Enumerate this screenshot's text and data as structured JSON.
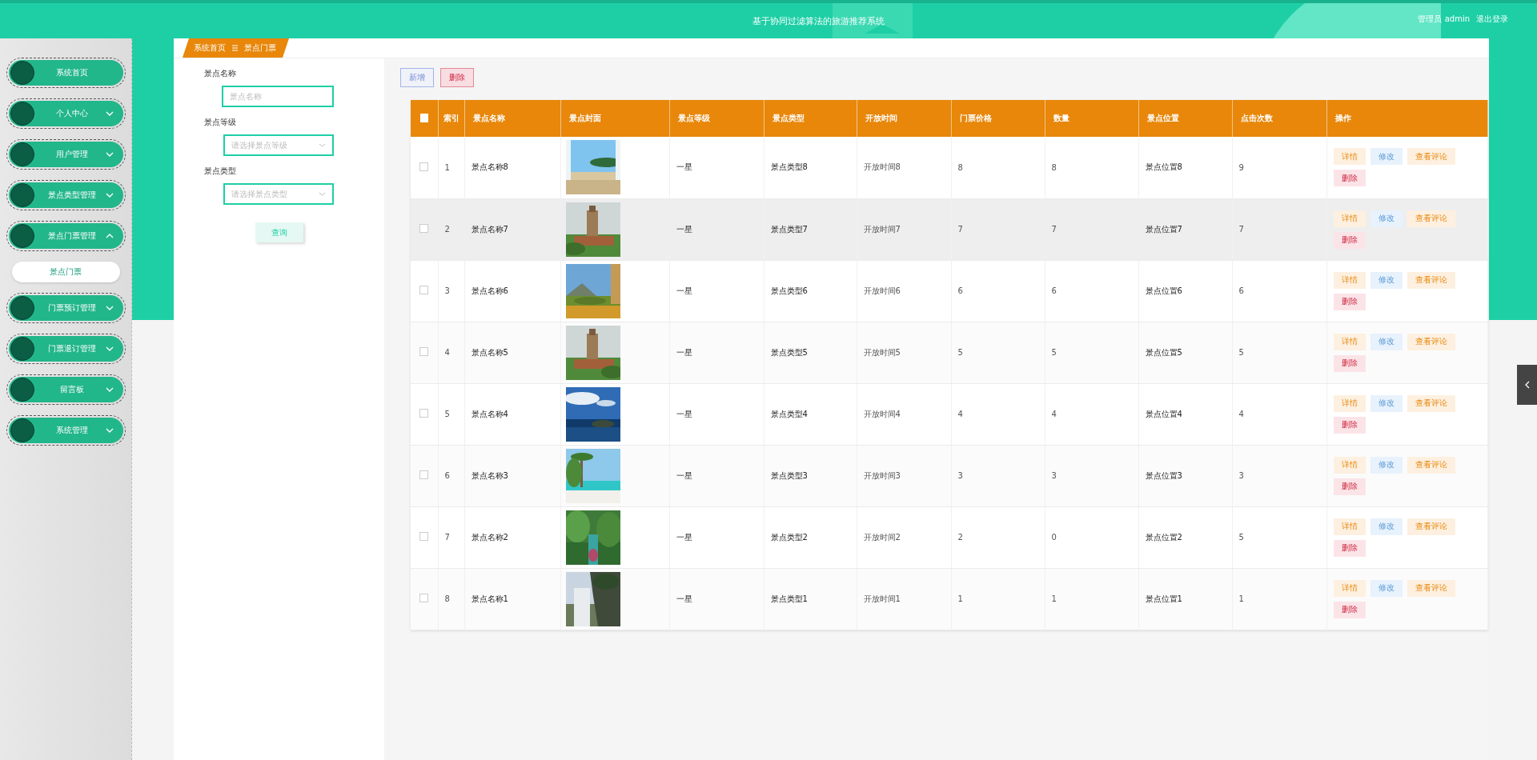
{
  "header": {
    "title": "基于协同过滤算法的旅游推荐系统",
    "user": "管理员 admin",
    "logout": "退出登录"
  },
  "sidebar": {
    "items": [
      {
        "label": "系统首页",
        "kind": "link"
      },
      {
        "label": "个人中心",
        "kind": "group",
        "expanded": false
      },
      {
        "label": "用户管理",
        "kind": "group",
        "expanded": false
      },
      {
        "label": "景点类型管理",
        "kind": "group",
        "expanded": false
      },
      {
        "label": "景点门票管理",
        "kind": "group",
        "expanded": true,
        "children": [
          {
            "label": "景点门票",
            "selected": true
          }
        ]
      },
      {
        "label": "门票预订管理",
        "kind": "group",
        "expanded": false
      },
      {
        "label": "门票退订管理",
        "kind": "group",
        "expanded": false
      },
      {
        "label": "留言板",
        "kind": "group",
        "expanded": false
      },
      {
        "label": "系统管理",
        "kind": "group",
        "expanded": false
      }
    ]
  },
  "breadcrumb": [
    "系统首页",
    "景点门票"
  ],
  "filters": [
    {
      "label": "景点名称",
      "kind": "input",
      "placeholder": "景点名称"
    },
    {
      "label": "景点等级",
      "kind": "select",
      "placeholder": "请选择景点等级"
    },
    {
      "label": "景点类型",
      "kind": "select",
      "placeholder": "请选择景点类型"
    }
  ],
  "search_button": "查询",
  "toolbar": [
    {
      "label": "新增",
      "kind": "add"
    },
    {
      "label": "删除",
      "kind": "delete"
    }
  ],
  "table": {
    "select_all_checked": false,
    "columns": [
      "索引",
      "景点名称",
      "景点封面",
      "景点等级",
      "景点类型",
      "开放时间",
      "门票价格",
      "数量",
      "景点位置",
      "点击次数",
      "操作"
    ],
    "rows": [
      {
        "checked": false,
        "hovered": false,
        "cells": [
          "1",
          "景点名称8",
          {
            "kind": "picture"
          },
          "一星",
          "景点类型8",
          "开放时间8",
          "8",
          "8",
          "景点位置8",
          "9"
        ],
        "actions": [
          "详情",
          "修改",
          "查看评论",
          "删除"
        ]
      },
      {
        "checked": false,
        "hovered": true,
        "cells": [
          "2",
          "景点名称7",
          {
            "kind": "picture"
          },
          "一星",
          "景点类型7",
          "开放时间7",
          "7",
          "7",
          "景点位置7",
          "7"
        ],
        "actions": [
          "详情",
          "修改",
          "查看评论",
          "删除"
        ]
      },
      {
        "checked": false,
        "hovered": false,
        "cells": [
          "3",
          "景点名称6",
          {
            "kind": "picture"
          },
          "一星",
          "景点类型6",
          "开放时间6",
          "6",
          "6",
          "景点位置6",
          "6"
        ],
        "actions": [
          "详情",
          "修改",
          "查看评论",
          "删除"
        ]
      },
      {
        "checked": false,
        "hovered": false,
        "cells": [
          "4",
          "景点名称5",
          {
            "kind": "picture"
          },
          "一星",
          "景点类型5",
          "开放时间5",
          "5",
          "5",
          "景点位置5",
          "5"
        ],
        "actions": [
          "详情",
          "修改",
          "查看评论",
          "删除"
        ]
      },
      {
        "checked": false,
        "hovered": false,
        "cells": [
          "5",
          "景点名称4",
          {
            "kind": "picture"
          },
          "一星",
          "景点类型4",
          "开放时间4",
          "4",
          "4",
          "景点位置4",
          "4"
        ],
        "actions": [
          "详情",
          "修改",
          "查看评论",
          "删除"
        ]
      },
      {
        "checked": false,
        "hovered": false,
        "cells": [
          "6",
          "景点名称3",
          {
            "kind": "picture"
          },
          "一星",
          "景点类型3",
          "开放时间3",
          "3",
          "3",
          "景点位置3",
          "3"
        ],
        "actions": [
          "详情",
          "修改",
          "查看评论",
          "删除"
        ]
      },
      {
        "checked": false,
        "hovered": false,
        "cells": [
          "7",
          "景点名称2",
          {
            "kind": "picture"
          },
          "一星",
          "景点类型2",
          "开放时间2",
          "2",
          "0",
          "景点位置2",
          "5"
        ],
        "actions": [
          "详情",
          "修改",
          "查看评论",
          "删除"
        ]
      },
      {
        "checked": false,
        "hovered": false,
        "cells": [
          "8",
          "景点名称1",
          {
            "kind": "picture"
          },
          "一星",
          "景点类型1",
          "开放时间1",
          "1",
          "1",
          "景点位置1",
          "1"
        ],
        "actions": [
          "详情",
          "修改",
          "查看评论",
          "删除"
        ]
      }
    ]
  }
}
